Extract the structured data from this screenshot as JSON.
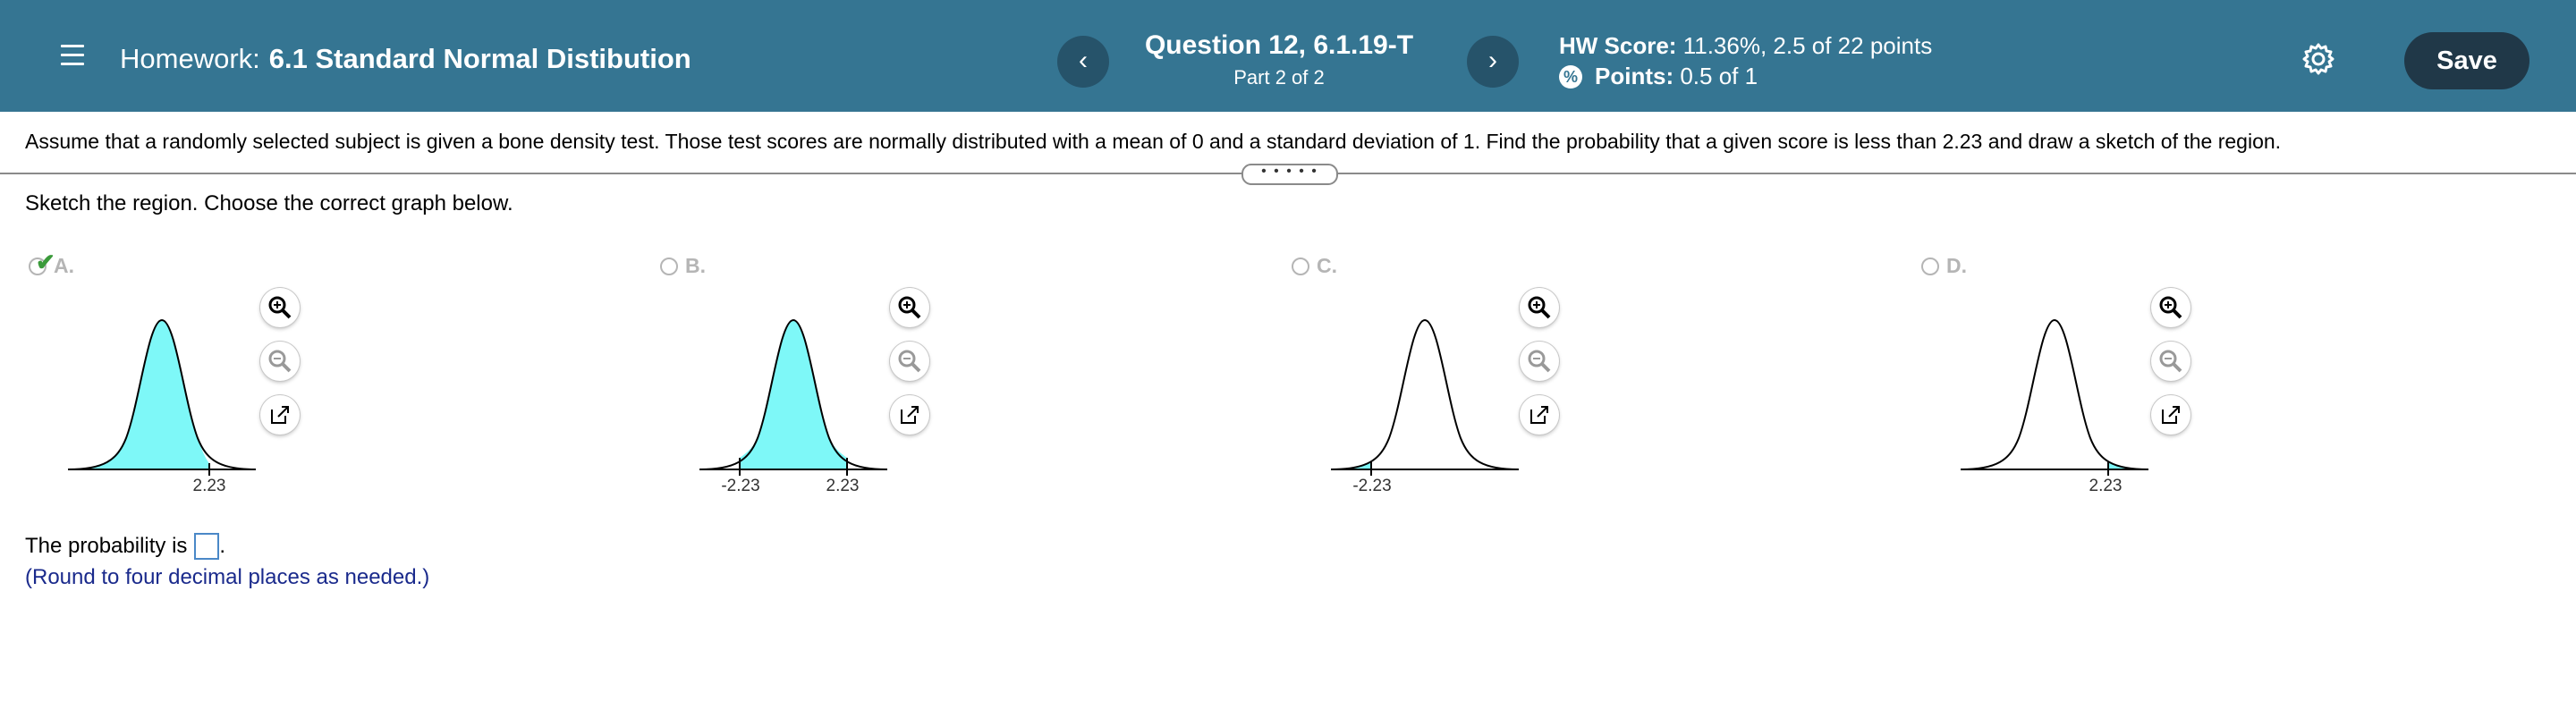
{
  "header": {
    "menu_icon": "hamburger-menu-icon",
    "homework_prefix": "Homework:",
    "homework_name": "6.1 Standard Normal Distibution",
    "prev_label": "‹",
    "next_label": "›",
    "question_title": "Question 12, 6.1.19-T",
    "question_part": "Part 2 of 2",
    "hw_score_label": "HW Score:",
    "hw_score_value": "11.36%, 2.5 of 22 points",
    "points_label": "Points:",
    "points_value": "0.5 of 1",
    "points_icon": "%",
    "settings_icon": "gear-icon",
    "save_label": "Save",
    "bg_color": "#357592"
  },
  "question": {
    "text": "Assume that a randomly selected subject is given a bone density test. Those test scores are normally distributed with a mean of 0 and a standard deviation of 1. Find the probability that a given score is less than 2.23 and draw a sketch of the region.",
    "divider_handle": "• • • • •",
    "instruction": "Sketch the region. Choose the correct graph below."
  },
  "options": [
    {
      "letter": "A.",
      "selected": true,
      "shading": "left of 2.23",
      "ticks": [
        "2.23"
      ]
    },
    {
      "letter": "B.",
      "selected": false,
      "shading": "between -2.23 and 2.23",
      "ticks": [
        "-2.23",
        "2.23"
      ]
    },
    {
      "letter": "C.",
      "selected": false,
      "shading": "left of -2.23",
      "ticks": [
        "-2.23"
      ]
    },
    {
      "letter": "D.",
      "selected": false,
      "shading": "right of 2.23",
      "ticks": [
        "2.23"
      ]
    }
  ],
  "answer": {
    "prompt": "The probability is",
    "period": ".",
    "hint": "(Round to four decimal places as needed.)"
  },
  "colors": {
    "shade": "#7ef8f8",
    "save_bg": "#203848"
  }
}
